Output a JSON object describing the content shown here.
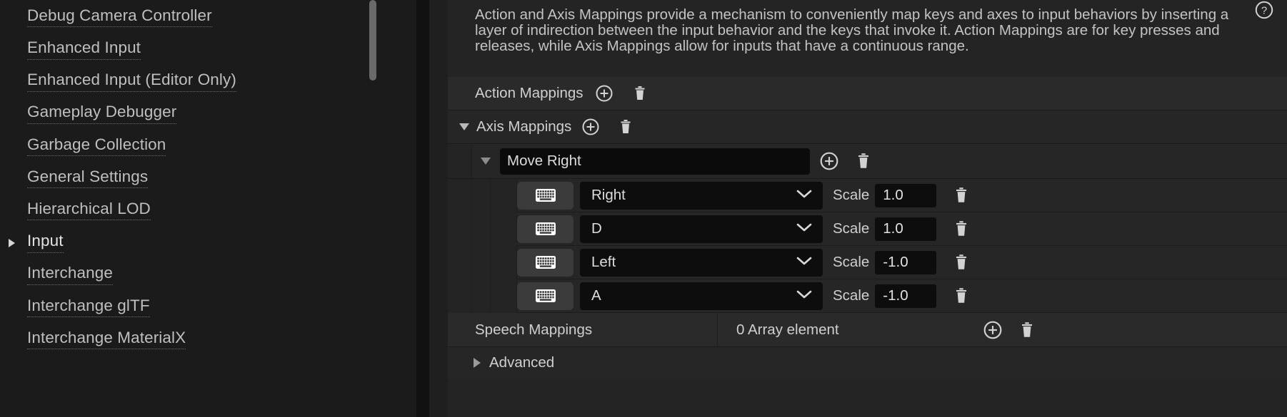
{
  "sidebar": {
    "items": [
      {
        "label": "Debug Camera Controller",
        "expandable": false,
        "selected": false
      },
      {
        "label": "Enhanced Input",
        "expandable": false,
        "selected": false
      },
      {
        "label": "Enhanced Input (Editor Only)",
        "expandable": false,
        "selected": false
      },
      {
        "label": "Gameplay Debugger",
        "expandable": false,
        "selected": false
      },
      {
        "label": "Garbage Collection",
        "expandable": false,
        "selected": false
      },
      {
        "label": "General Settings",
        "expandable": false,
        "selected": false
      },
      {
        "label": "Hierarchical LOD",
        "expandable": false,
        "selected": false
      },
      {
        "label": "Input",
        "expandable": true,
        "selected": true
      },
      {
        "label": "Interchange",
        "expandable": false,
        "selected": false
      },
      {
        "label": "Interchange glTF",
        "expandable": false,
        "selected": false
      },
      {
        "label": "Interchange MaterialX",
        "expandable": false,
        "selected": false
      }
    ]
  },
  "details": {
    "description": "Action and Axis Mappings provide a mechanism to conveniently map keys and axes to input behaviors by inserting a layer of indirection between the input behavior and the keys that invoke it. Action Mappings are for key presses and releases, while Axis Mappings allow for inputs that have a continuous range.",
    "help_icon": "help-circle-icon",
    "action_mappings": {
      "label": "Action Mappings",
      "add_icon": "plus-circle-icon",
      "delete_icon": "trash-icon"
    },
    "axis_mappings": {
      "label": "Axis Mappings",
      "expanded": true,
      "add_icon": "plus-circle-icon",
      "delete_icon": "trash-icon",
      "elements": [
        {
          "name": "Move Right",
          "expanded": true,
          "add_icon": "plus-circle-icon",
          "delete_icon": "trash-icon",
          "keys": [
            {
              "device_icon": "keyboard-icon",
              "key": "Right",
              "scale_label": "Scale",
              "scale": "1.0",
              "delete_icon": "trash-icon"
            },
            {
              "device_icon": "keyboard-icon",
              "key": "D",
              "scale_label": "Scale",
              "scale": "1.0",
              "delete_icon": "trash-icon"
            },
            {
              "device_icon": "keyboard-icon",
              "key": "Left",
              "scale_label": "Scale",
              "scale": "-1.0",
              "delete_icon": "trash-icon"
            },
            {
              "device_icon": "keyboard-icon",
              "key": "A",
              "scale_label": "Scale",
              "scale": "-1.0",
              "delete_icon": "trash-icon"
            }
          ]
        }
      ]
    },
    "speech_mappings": {
      "label": "Speech Mappings",
      "value": "0 Array element",
      "add_icon": "plus-circle-icon",
      "delete_icon": "trash-icon"
    },
    "advanced": {
      "label": "Advanced",
      "expanded": false
    }
  },
  "colors": {
    "panel_bg": "#242424",
    "sidebar_bg": "#1b1b1b",
    "row_bg": "#2a2a2a",
    "field_bg": "#0d0d0d",
    "text": "#cfcfcf",
    "muted_text": "#bfbfbf"
  }
}
